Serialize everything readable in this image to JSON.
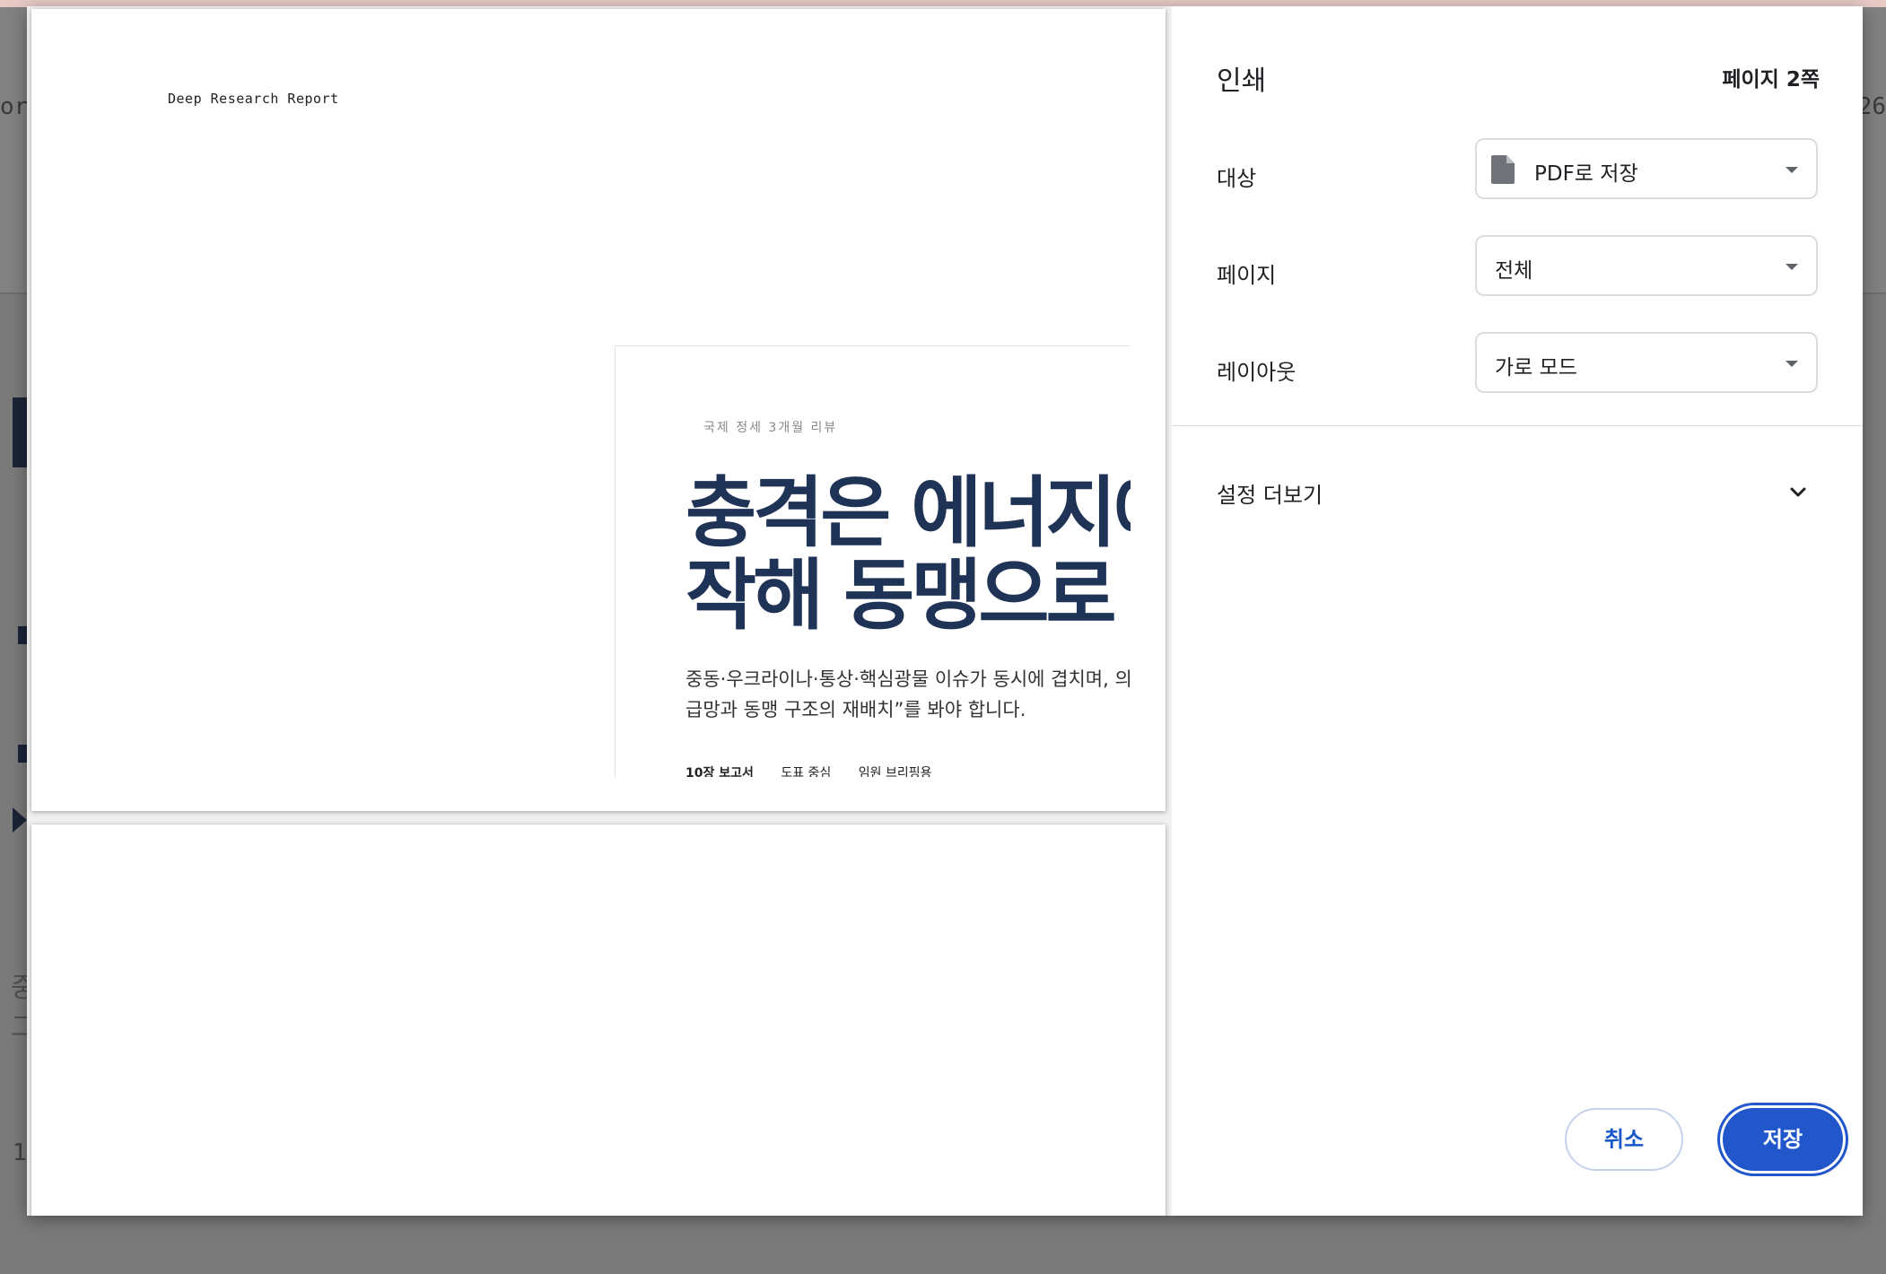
{
  "background": {
    "left_fragment": "ort",
    "right_fragment": "26",
    "side_text": [
      "중",
      "그"
    ],
    "side_number": "1"
  },
  "preview": {
    "running_header": "Deep Research Report",
    "cover": {
      "kicker": "국제 정세 3개월 리뷰",
      "title_lines": [
        "충격은 에너지에서 시",
        "작해 동맹으로 번"
      ],
      "description_lines": [
        "중동·우크라이나·통상·핵심광물 이슈가 동시에 겹치며, 의",
        "급망과 동맹 구조의 재배치”를 봐야 합니다."
      ],
      "meta": [
        "10장 보고서",
        "도표 중심",
        "임원 브리핑용"
      ]
    }
  },
  "print_settings": {
    "title": "인쇄",
    "page_count": "페이지 2쪽",
    "destination": {
      "label": "대상",
      "value": "PDF로 저장",
      "icon": "file-icon"
    },
    "pages": {
      "label": "페이지",
      "value": "전체"
    },
    "layout": {
      "label": "레이아웃",
      "value": "가로 모드"
    },
    "more_settings": {
      "label": "설정 더보기",
      "icon": "chevron-down-icon"
    },
    "buttons": {
      "cancel": "취소",
      "save": "저장"
    }
  },
  "colors": {
    "accent": "#2257cc",
    "cover_title": "#1f3357",
    "overlay": "#7a7a7a"
  }
}
